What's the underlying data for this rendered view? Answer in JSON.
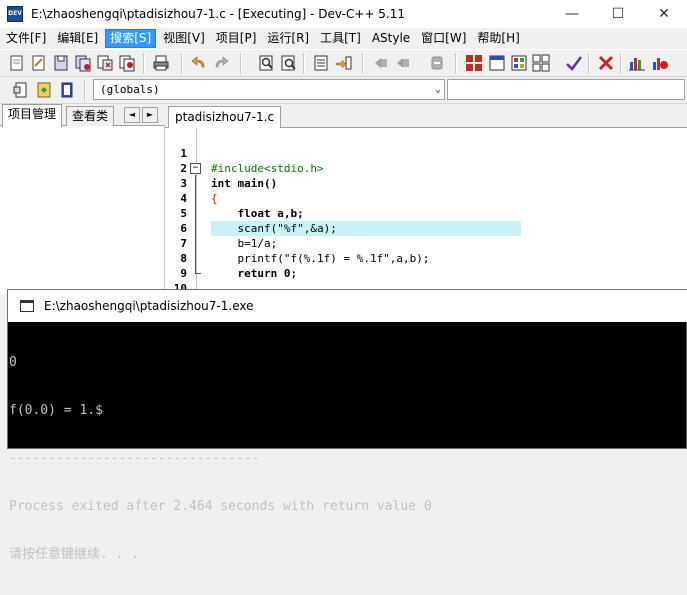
{
  "window": {
    "title": "E:\\zhaoshengqi\\ptadisizhou7-1.c - [Executing] - Dev-C++ 5.11",
    "app_icon_text": "DEV",
    "minimize": "—",
    "maximize": "☐",
    "close": "✕"
  },
  "menu": {
    "items": [
      "文件[F]",
      "编辑[E]",
      "搜索[S]",
      "视图[V]",
      "项目[P]",
      "运行[R]",
      "工具[T]",
      "AStyle",
      "窗口[W]",
      "帮助[H]"
    ],
    "active_index": 2
  },
  "toolbar2": {
    "globals_value": "(globals)"
  },
  "left_panel": {
    "tabs": [
      "项目管理",
      "查看类"
    ],
    "scroll_left": "◄",
    "scroll_right": "►"
  },
  "editor": {
    "tab_label": "ptadisizhou7-1.c",
    "highlight_line": 5,
    "lines": [
      {
        "n": "1",
        "text": "#include<stdio.h>"
      },
      {
        "n": "2",
        "text": "int main()"
      },
      {
        "n": "3",
        "text": "{"
      },
      {
        "n": "4",
        "text": "    float a,b;"
      },
      {
        "n": "5",
        "text": "    scanf(\"%f\",&a);"
      },
      {
        "n": "6",
        "text": "    b=1/a;"
      },
      {
        "n": "7",
        "text": "    printf(\"f(%.1f) = %.1f\",a,b);"
      },
      {
        "n": "8",
        "text": "    return 0;"
      },
      {
        "n": "9",
        "text": ""
      },
      {
        "n": "10",
        "text": " }"
      }
    ]
  },
  "console": {
    "title": "E:\\zhaoshengqi\\ptadisizhou7-1.exe",
    "lines": [
      "0",
      "f(0.0) = 1.$",
      "--------------------------------",
      "Process exited after 2.464 seconds with return value 0",
      "请按任意键继续. . ."
    ]
  },
  "colors": {
    "menu_active": "#3399ff",
    "line_highlight": "#c8f2f6",
    "preprocessor": "#008000",
    "string": "#0000ff",
    "number": "#800080",
    "symbol": "#ff0000",
    "console_bg": "#000000",
    "console_fg": "#c0c0c0"
  }
}
